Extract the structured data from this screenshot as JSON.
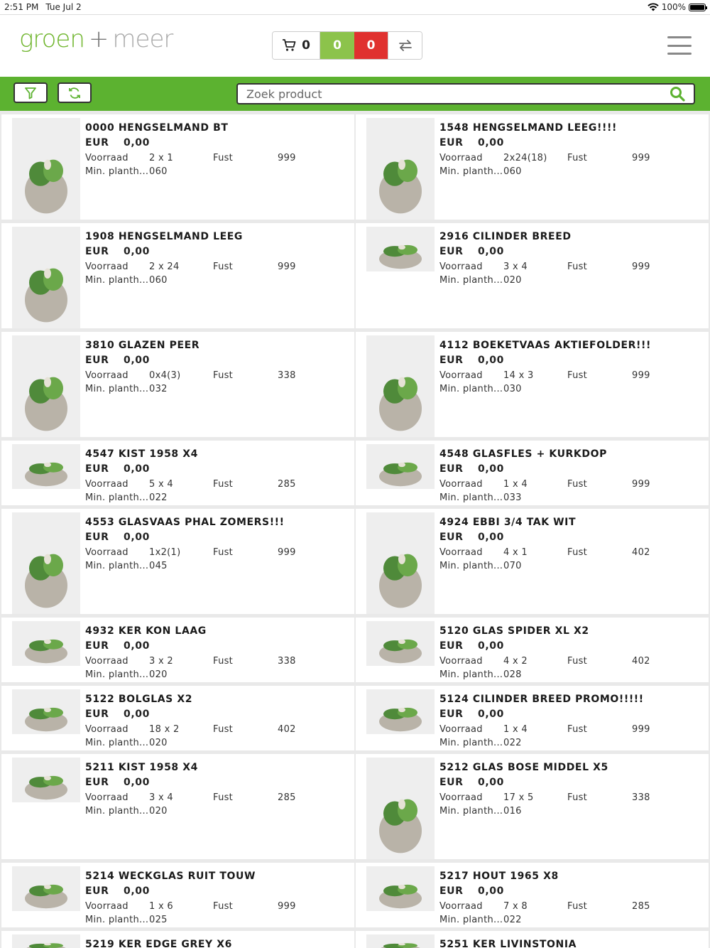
{
  "status": {
    "time": "2:51 PM",
    "date": "Tue Jul 2",
    "battery": "100%"
  },
  "brand": {
    "part1": "groen",
    "plus": "+",
    "part2": "meer"
  },
  "counters": {
    "cart": "0",
    "green": "0",
    "red": "0"
  },
  "search": {
    "placeholder": "Zoek product"
  },
  "labels": {
    "currency": "EUR",
    "stock": "Voorraad",
    "minplant": "Min. planth...",
    "fust": "Fust"
  },
  "products": [
    {
      "title": "0000 HENGSELMAND BT",
      "price": "0,00",
      "stock": "2 x 1",
      "minplant": "060",
      "fust": "999",
      "thumb": "basket-flowers-icon"
    },
    {
      "title": "1548 HENGSELMAND LEEG!!!!",
      "price": "0,00",
      "stock": "2x24(18)",
      "minplant": "060",
      "fust": "999",
      "thumb": "basket-icon"
    },
    {
      "title": "1908 HENGSELMAND LEEG",
      "price": "0,00",
      "stock": "2 x 24",
      "minplant": "060",
      "fust": "999",
      "thumb": "basket-icon"
    },
    {
      "title": "2916 CILINDER BREED",
      "price": "0,00",
      "stock": "3 x 4",
      "minplant": "020",
      "fust": "999",
      "thumb": "glass-pots-icon"
    },
    {
      "title": "3810 GLAZEN PEER",
      "price": "0,00",
      "stock": "0x4(3)",
      "minplant": "032",
      "fust": "338",
      "thumb": "glass-pear-icon"
    },
    {
      "title": "4112 BOEKETVAAS AKTIEFOLDER!!!",
      "price": "0,00",
      "stock": "14 x 3",
      "minplant": "030",
      "fust": "999",
      "thumb": "bouquet-vase-icon"
    },
    {
      "title": "4547 KIST 1958 X4",
      "price": "0,00",
      "stock": "5 x 4",
      "minplant": "022",
      "fust": "285",
      "thumb": "crate-plants-icon"
    },
    {
      "title": "4548 GLASFLES + KURKDOP",
      "price": "0,00",
      "stock": "1 x 4",
      "minplant": "033",
      "fust": "999",
      "thumb": "glass-bottles-icon"
    },
    {
      "title": "4553 GLASVAAS PHAL ZOMERS!!!",
      "price": "0,00",
      "stock": "1x2(1)",
      "minplant": "045",
      "fust": "999",
      "thumb": "orchid-glass-icon"
    },
    {
      "title": "4924 EBBI 3/4 TAK WIT",
      "price": "0,00",
      "stock": "4 x 1",
      "minplant": "070",
      "fust": "402",
      "thumb": "orchid-pot-icon"
    },
    {
      "title": "4932 KER KON LAAG",
      "price": "0,00",
      "stock": "3 x 2",
      "minplant": "020",
      "fust": "338",
      "thumb": "ceramic-bowls-icon"
    },
    {
      "title": "5120 GLAS SPIDER XL X2",
      "price": "0,00",
      "stock": "4 x 2",
      "minplant": "028",
      "fust": "402",
      "thumb": "glass-pots-icon"
    },
    {
      "title": "5122 BOLGLAS X2",
      "price": "0,00",
      "stock": "18 x 2",
      "minplant": "020",
      "fust": "402",
      "thumb": "glass-pots-icon"
    },
    {
      "title": "5124 CILINDER BREED PROMO!!!!!",
      "price": "0,00",
      "stock": "1 x 4",
      "minplant": "022",
      "fust": "999",
      "thumb": "glass-pots-icon"
    },
    {
      "title": "5211 KIST 1958 X4",
      "price": "0,00",
      "stock": "3 x 4",
      "minplant": "020",
      "fust": "285",
      "thumb": "crate-plants-icon"
    },
    {
      "title": "5212 GLAS BOSE MIDDEL X5",
      "price": "0,00",
      "stock": "17 x 5",
      "minplant": "016",
      "fust": "338",
      "thumb": "glass-bowl-icon"
    },
    {
      "title": "5214 WECKGLAS RUIT TOUW",
      "price": "0,00",
      "stock": "1 x 6",
      "minplant": "025",
      "fust": "999",
      "thumb": "glass-jars-icon"
    },
    {
      "title": "5217 HOUT 1965 X8",
      "price": "0,00",
      "stock": "7 x 8",
      "minplant": "022",
      "fust": "285",
      "thumb": "crate-plants-icon"
    },
    {
      "title": "5219 KER EDGE GREY X6",
      "thumb": "ceramic-bowls-icon"
    },
    {
      "title": "5251 KER LIVINSTONIA",
      "thumb": "palm-icon"
    }
  ]
}
